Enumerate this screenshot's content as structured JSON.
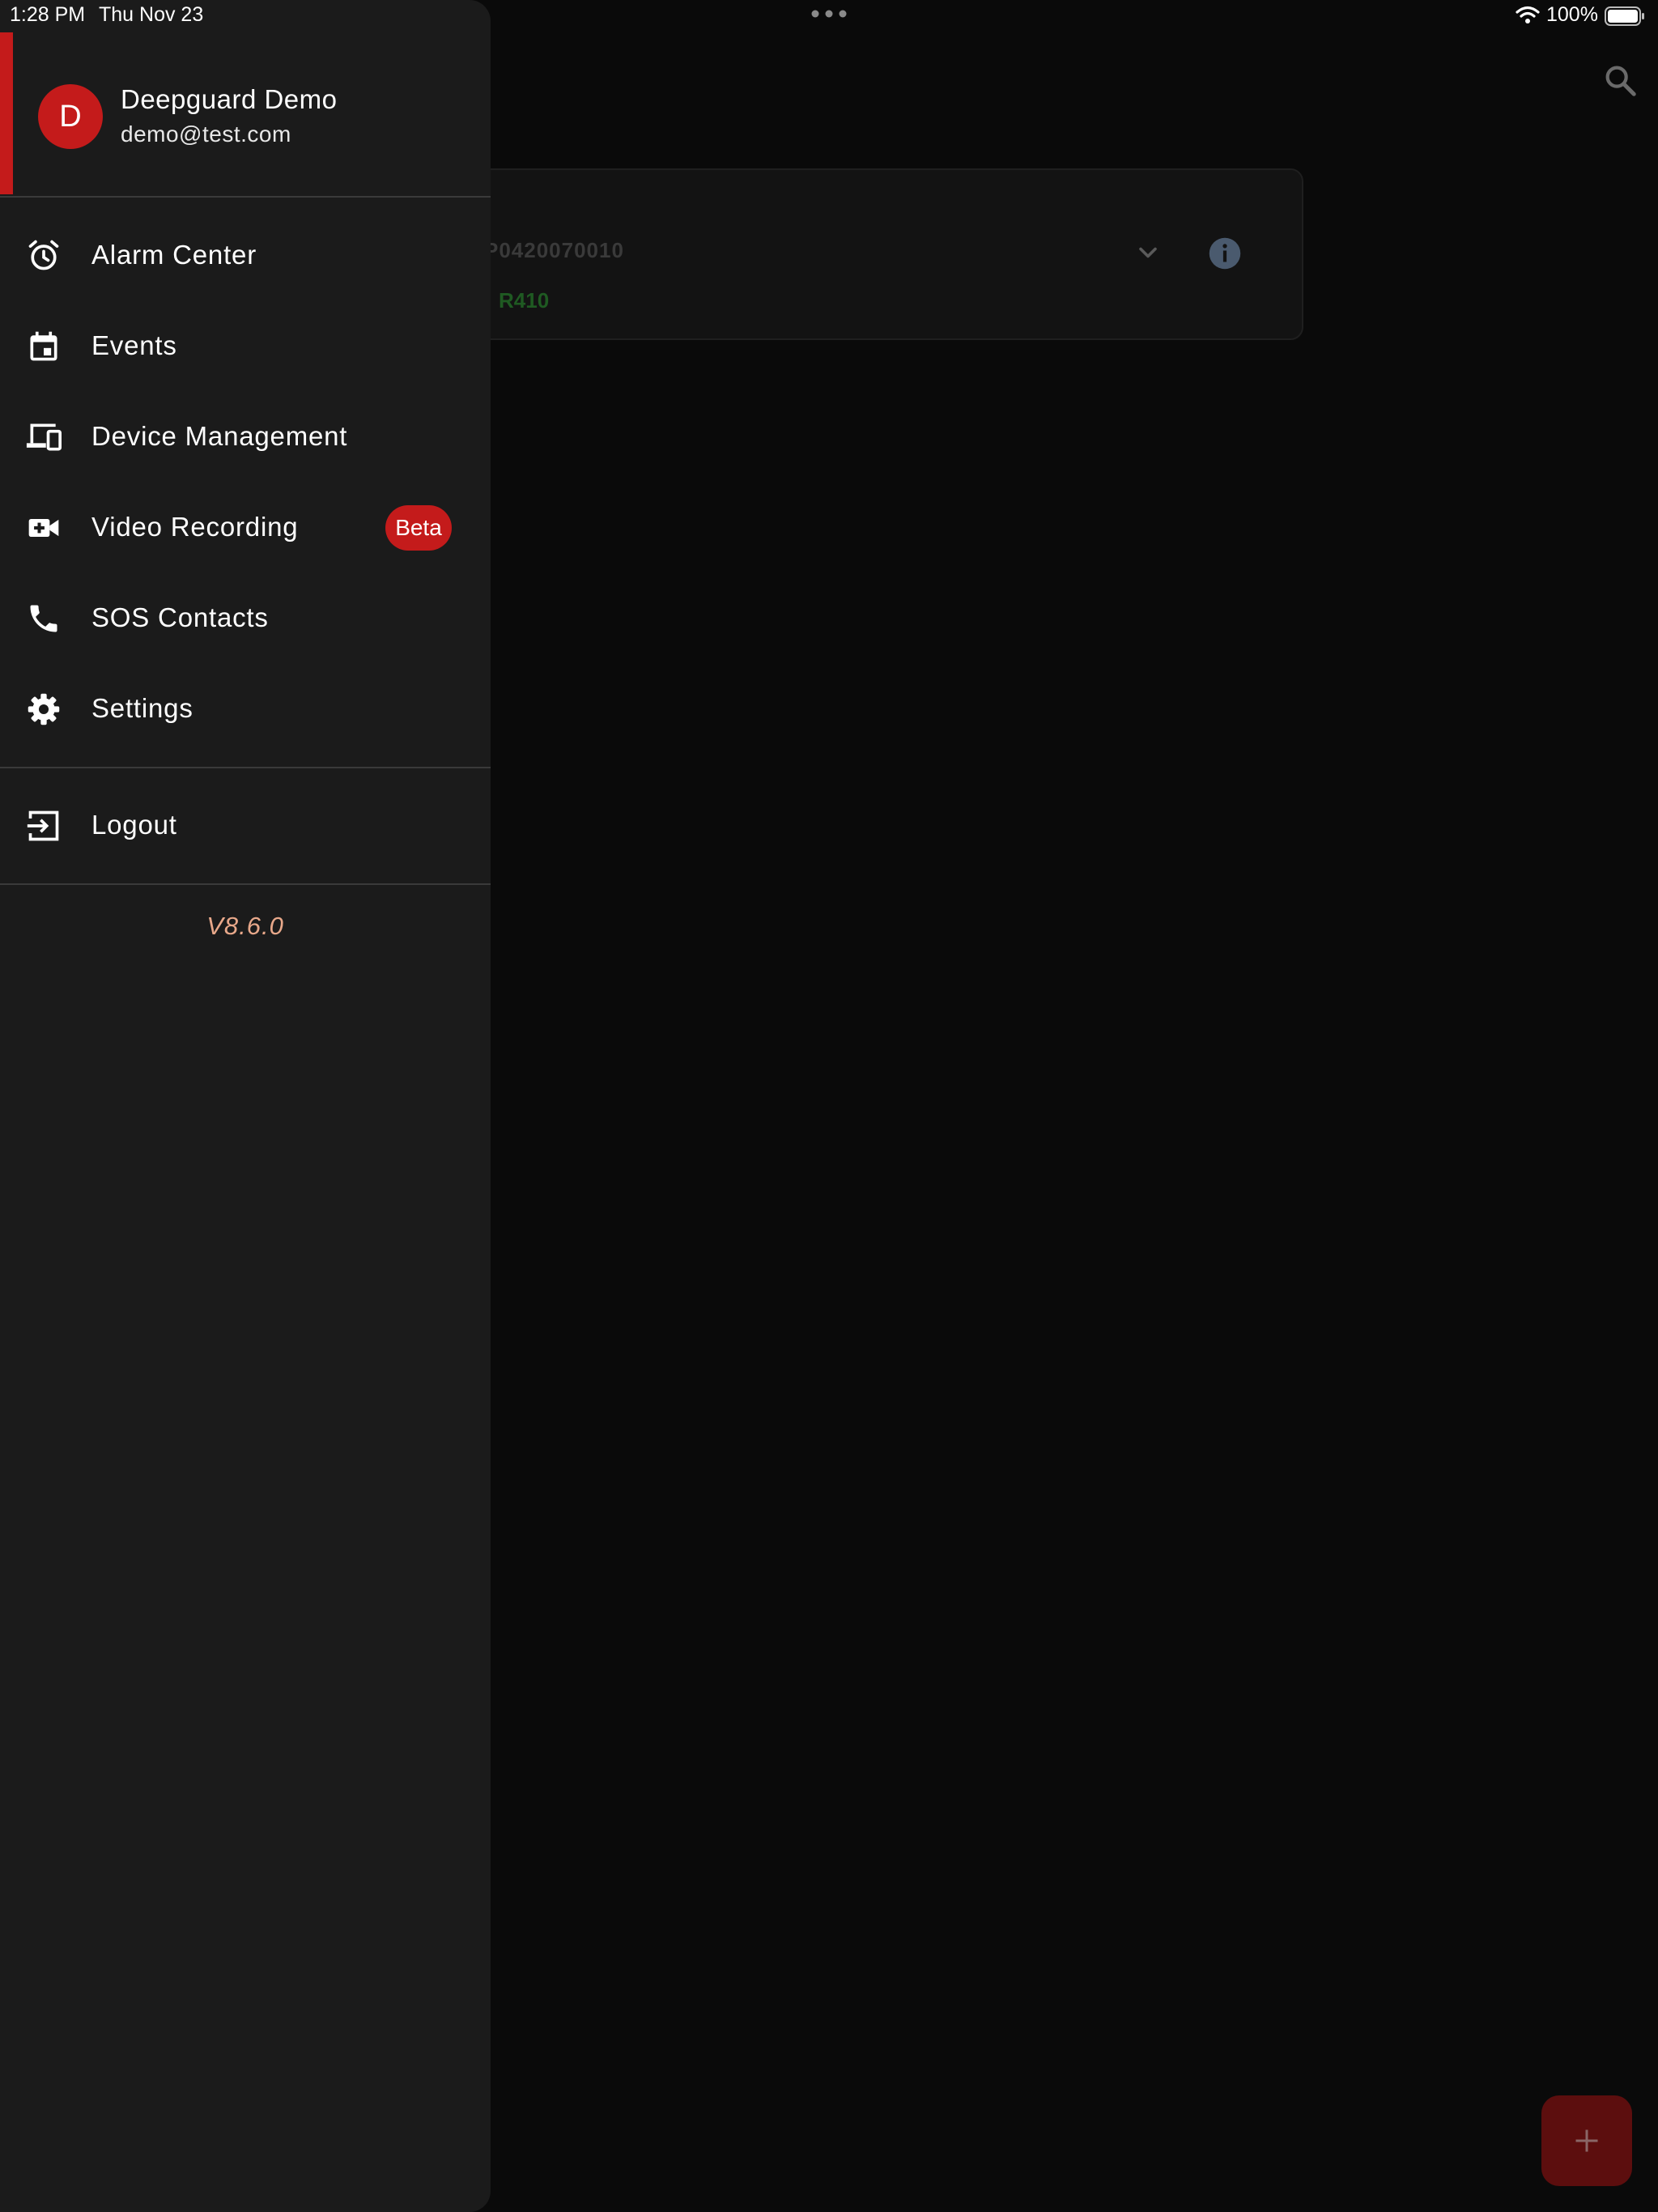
{
  "status_bar": {
    "time": "1:28 PM",
    "date": "Thu Nov 23",
    "battery_percent": "100%",
    "icons": [
      "multitasking-dots-icon",
      "wifi-icon",
      "battery-icon"
    ]
  },
  "background": {
    "device_card": {
      "serial": "P0420070010",
      "model": "R410",
      "icons": [
        "chevron-down-icon",
        "info-icon"
      ]
    },
    "fab_icon": "plus-icon",
    "search_icon": "search-icon"
  },
  "drawer": {
    "user": {
      "avatar_initial": "D",
      "name": "Deepguard Demo",
      "email": "demo@test.com"
    },
    "menu": [
      {
        "label": "Alarm Center",
        "icon": "alarm-clock-icon"
      },
      {
        "label": "Events",
        "icon": "calendar-icon"
      },
      {
        "label": "Device Management",
        "icon": "devices-icon"
      },
      {
        "label": "Video Recording",
        "icon": "video-camera-add-icon",
        "badge": "Beta"
      },
      {
        "label": "SOS Contacts",
        "icon": "phone-icon"
      },
      {
        "label": "Settings",
        "icon": "gear-icon"
      }
    ],
    "logout": {
      "label": "Logout",
      "icon": "logout-icon"
    },
    "version": "V8.6.0"
  },
  "colors": {
    "accent_red": "#c41b1b",
    "drawer_bg": "#1b1b1b",
    "screen_bg": "#0a0a0a",
    "version_text": "#e8a88a",
    "info_icon": "#5a6b80"
  }
}
